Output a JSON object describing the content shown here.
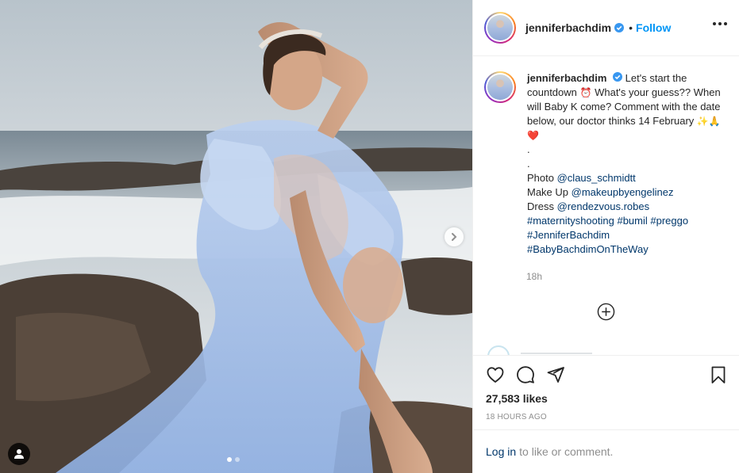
{
  "post": {
    "username": "jenniferbachdim",
    "follow_label": "Follow",
    "separator": "•",
    "caption": {
      "username": "jenniferbachdim",
      "text_line1": "Let's start the countdown",
      "alarm_emoji": "⏰",
      "text_line1b": "What's your guess??",
      "text_line2": "When will Baby K come? Comment with the date below, our doctor thinks 14 February",
      "emojis": "✨🙏❤️",
      "dot1": ".",
      "dot2": ".",
      "photo_prefix": "Photo",
      "photo_link": "@claus_schmidtt",
      "makeup_prefix": "Make Up",
      "makeup_link": "@makeupbyengelinez",
      "dress_prefix": "Dress",
      "dress_link": "@rendezvous.robes",
      "hashtags_line1": [
        "#maternityshooting",
        "#bumil",
        "#preggo"
      ],
      "hashtag_line2": "#JenniferBachdim",
      "hashtag_line3": "#BabyBachdimOnTheWay"
    },
    "relative_time": "18h",
    "likes": "27,583 likes",
    "posted_time": "18 HOURS AGO",
    "login_link": "Log in",
    "login_suffix": "to like or comment.",
    "carousel": {
      "total": 2,
      "current": 1
    }
  },
  "colors": {
    "accent": "#0095f6",
    "link": "#00376b",
    "muted": "#8e8e8e",
    "text": "#262626",
    "dress": "#a9c1e8"
  },
  "icons": [
    "verified-icon",
    "more-icon",
    "chevron-right-icon",
    "user-tag-icon",
    "heart-icon",
    "comment-icon",
    "share-icon",
    "bookmark-icon",
    "plus-circle-icon"
  ]
}
